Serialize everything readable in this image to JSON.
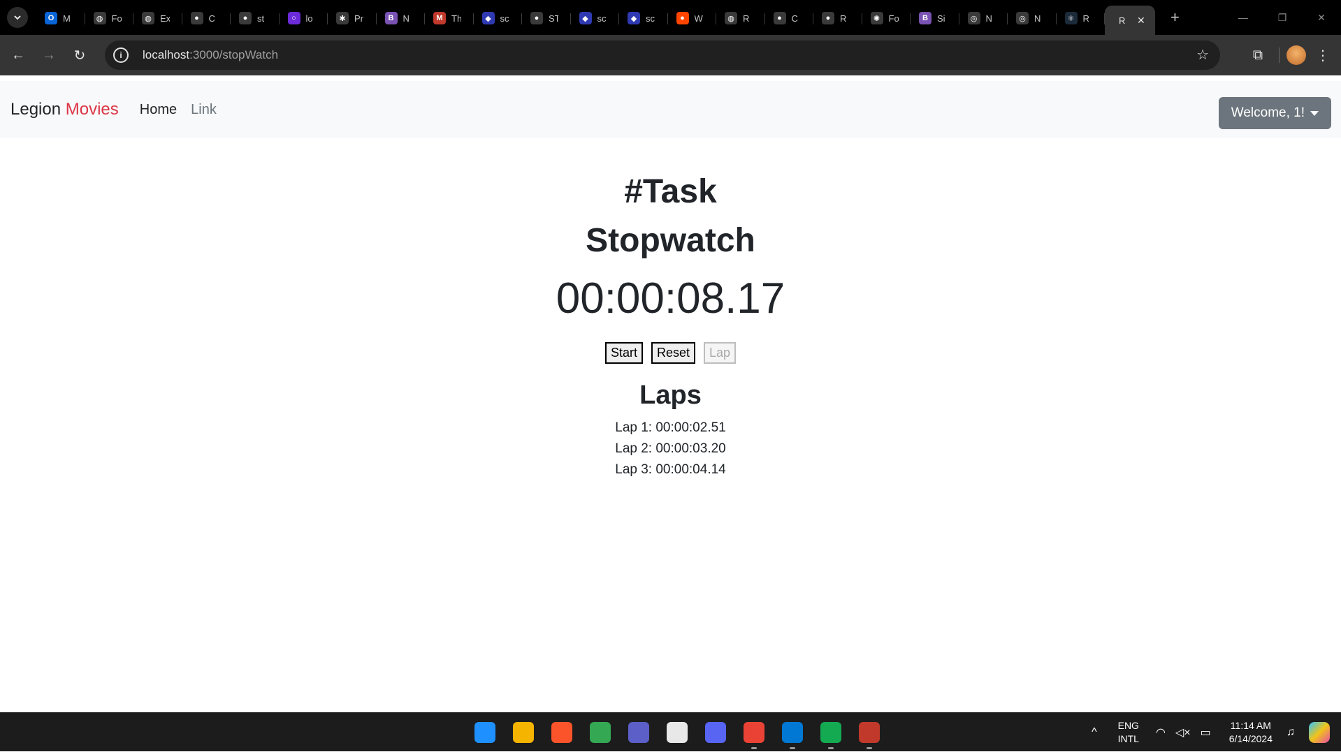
{
  "browser": {
    "tabs": [
      {
        "icon": "outlook-icon",
        "color": "#0a64d6",
        "glyph": "O",
        "title": "M"
      },
      {
        "icon": "globe-icon",
        "color": "#3a3a3a",
        "glyph": "◍",
        "title": "Fo"
      },
      {
        "icon": "globe-icon",
        "color": "#3a3a3a",
        "glyph": "◍",
        "title": "Ex"
      },
      {
        "icon": "github-icon",
        "color": "#3a3a3a",
        "glyph": "●",
        "title": "C"
      },
      {
        "icon": "github-icon",
        "color": "#3a3a3a",
        "glyph": "●",
        "title": "st"
      },
      {
        "icon": "ring-icon",
        "color": "#6c2bd9",
        "glyph": "○",
        "title": "lo"
      },
      {
        "icon": "asterisk-icon",
        "color": "#3a3a3a",
        "glyph": "✱",
        "title": "Pr"
      },
      {
        "icon": "bootstrap-icon",
        "color": "#7952b3",
        "glyph": "B",
        "title": "N"
      },
      {
        "icon": "mashup-icon",
        "color": "#c0392b",
        "glyph": "M",
        "title": "Th"
      },
      {
        "icon": "shield-icon",
        "color": "#2f3ab2",
        "glyph": "◆",
        "title": "sc"
      },
      {
        "icon": "github-icon",
        "color": "#3a3a3a",
        "glyph": "●",
        "title": "ST"
      },
      {
        "icon": "shield-icon",
        "color": "#2f3ab2",
        "glyph": "◆",
        "title": "sc"
      },
      {
        "icon": "shield-icon",
        "color": "#2f3ab2",
        "glyph": "◆",
        "title": "sc"
      },
      {
        "icon": "reddit-icon",
        "color": "#ff4500",
        "glyph": "●",
        "title": "W"
      },
      {
        "icon": "globe-icon",
        "color": "#3a3a3a",
        "glyph": "◍",
        "title": "R"
      },
      {
        "icon": "github-icon",
        "color": "#3a3a3a",
        "glyph": "●",
        "title": "C"
      },
      {
        "icon": "github-icon",
        "color": "#3a3a3a",
        "glyph": "●",
        "title": "R"
      },
      {
        "icon": "chatgpt-icon",
        "color": "#3a3a3a",
        "glyph": "✺",
        "title": "Fo"
      },
      {
        "icon": "bootstrap-icon",
        "color": "#7952b3",
        "glyph": "B",
        "title": "Si"
      },
      {
        "icon": "chrome-icon",
        "color": "#3a3a3a",
        "glyph": "◎",
        "title": "N"
      },
      {
        "icon": "chrome-icon",
        "color": "#3a3a3a",
        "glyph": "◎",
        "title": "N"
      },
      {
        "icon": "react-icon",
        "color": "#1c2b3a",
        "glyph": "⚛",
        "title": "R"
      }
    ],
    "active_tab": {
      "title": "R",
      "close": "✕"
    },
    "new_tab": "+",
    "url_host": "localhost",
    "url_rest": ":3000/stopWatch"
  },
  "navbar": {
    "brand_main": "Legion",
    "brand_accent": "Movies",
    "links": [
      "Home",
      "Link"
    ],
    "user_menu": "Welcome, 1!"
  },
  "main": {
    "task_heading": "#Task",
    "title": "Stopwatch",
    "time": "00:00:08.17",
    "buttons": {
      "start": "Start",
      "reset": "Reset",
      "lap": "Lap"
    },
    "laps_title": "Laps",
    "laps": [
      "Lap 1: 00:00:02.51",
      "Lap 2: 00:00:03.20",
      "Lap 3: 00:00:04.14"
    ]
  },
  "taskbar": {
    "apps": [
      {
        "name": "windows-start-icon",
        "color": "#1e90ff"
      },
      {
        "name": "file-explorer-icon",
        "color": "#f4b400"
      },
      {
        "name": "brave-icon",
        "color": "#fb542b"
      },
      {
        "name": "chrome-icon",
        "color": "#34a853"
      },
      {
        "name": "teams-icon",
        "color": "#5b5fc7"
      },
      {
        "name": "notepad-icon",
        "color": "#e8e8e8"
      },
      {
        "name": "discord-icon",
        "color": "#5865f2"
      },
      {
        "name": "chrome-profile-icon",
        "color": "#ea4335"
      },
      {
        "name": "vscode-icon",
        "color": "#0078d4"
      },
      {
        "name": "mongodb-icon",
        "color": "#13aa52"
      },
      {
        "name": "snipping-tool-icon",
        "color": "#c0392b"
      }
    ],
    "lang_top": "ENG",
    "lang_bottom": "INTL",
    "time": "11:14 AM",
    "date": "6/14/2024"
  }
}
